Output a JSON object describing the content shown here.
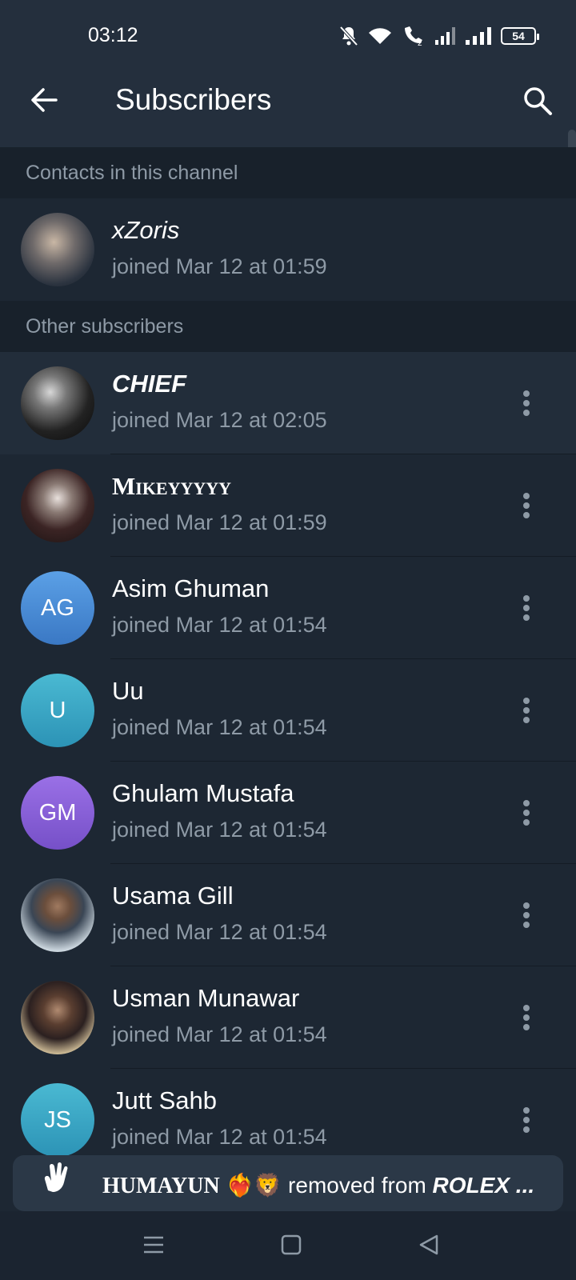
{
  "status_bar": {
    "time": "03:12",
    "battery": "54",
    "icons": [
      "bell-off-icon",
      "wifi-icon",
      "wifi-call-icon",
      "signal-icon",
      "signal-icon"
    ]
  },
  "header": {
    "title": "Subscribers",
    "back_icon": "arrow-left-icon",
    "search_icon": "search-icon"
  },
  "sections": {
    "contacts_title": "Contacts in this channel",
    "others_title": "Other subscribers"
  },
  "contacts": [
    {
      "name": "xZoris",
      "joined": "joined Mar 12 at 01:59",
      "avatar": "photo"
    }
  ],
  "subscribers": [
    {
      "name": "CHIEF",
      "joined": "joined Mar 12 at 02:05",
      "avatar": "photo"
    },
    {
      "name": "Mikeyyyyy",
      "joined": "joined Mar 12 at 01:59",
      "avatar": "photo"
    },
    {
      "name": "Asim Ghuman",
      "joined": "joined Mar 12 at 01:54",
      "initials": "AG",
      "color": "#4a8fd8"
    },
    {
      "name": "Uu",
      "joined": "joined Mar 12 at 01:54",
      "initials": "U",
      "color": "#3aa8c6"
    },
    {
      "name": "Ghulam Mustafa",
      "joined": "joined Mar 12 at 01:54",
      "initials": "GM",
      "color": "#8c62d9"
    },
    {
      "name": "Usama Gill",
      "joined": "joined Mar 12 at 01:54",
      "avatar": "photo"
    },
    {
      "name": "Usman Munawar",
      "joined": "joined Mar 12 at 01:54",
      "avatar": "photo"
    },
    {
      "name": "Jutt Sahb",
      "joined": "joined Mar 12 at 01:54",
      "initials": "JS",
      "color": "#3aa8c6"
    }
  ],
  "snackbar": {
    "name": "HUMAYUN",
    "emoji": "❤️‍🔥🦁",
    "middle": " removed from ",
    "target": "ROLEX",
    "ellipsis": " ..."
  },
  "colors": {
    "background": "#1d2733",
    "header": "#242f3d",
    "section": "#18212b",
    "secondary_text": "#8e9aa6"
  }
}
